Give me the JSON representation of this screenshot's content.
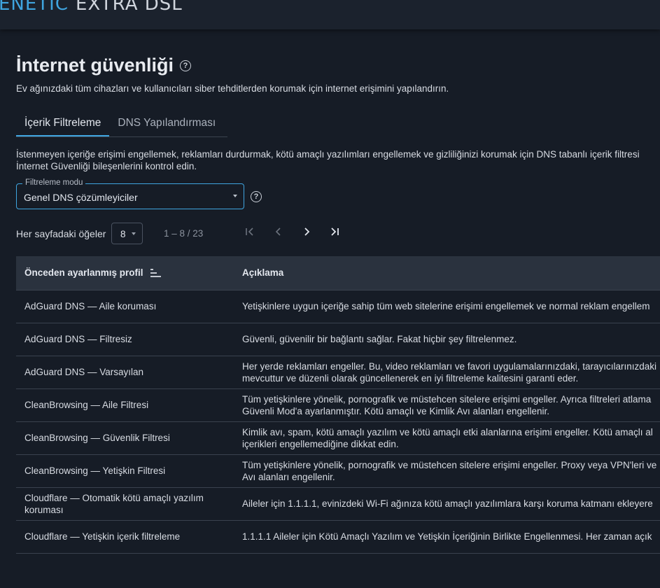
{
  "header": {
    "logo_part1": "ENETIC",
    "logo_part2": "EXTRA DSL"
  },
  "page": {
    "title": "İnternet güvenliği",
    "subtitle": "Ev ağınızdaki tüm cihazları ve kullanıcıları siber tehditlerden korumak için internet erişimini yapılandırın."
  },
  "tabs": [
    {
      "label": "İçerik Filtreleme",
      "active": true
    },
    {
      "label": "DNS Yapılandırması",
      "active": false
    }
  ],
  "content": {
    "description_line1": "İstenmeyen içeriğe erişimi engellemek, reklamları durdurmak, kötü amaçlı yazılımları engellemek ve gizliliğinizi korumak için DNS tabanlı içerik filtresi",
    "description_line2": "İnternet Güvenliği bileşenlerini kontrol edin.",
    "filter_mode": {
      "label": "Filtreleme modu",
      "value": "Genel DNS çözümleyiciler"
    }
  },
  "pagination": {
    "items_per_page_label": "Her sayfadaki öğeler",
    "items_per_page_value": "8",
    "range": "1 – 8 / 23"
  },
  "table": {
    "columns": [
      "Önceden ayarlanmış profil",
      "Açıklama"
    ],
    "rows": [
      {
        "profile": "AdGuard DNS — Aile koruması",
        "description": [
          "Yetişkinlere uygun içeriğe sahip tüm web sitelerine erişimi engellemek ve normal reklam engellem"
        ]
      },
      {
        "profile": "AdGuard DNS — Filtresiz",
        "description": [
          "Güvenli, güvenilir bir bağlantı sağlar. Fakat hiçbir şey filtrelenmez."
        ]
      },
      {
        "profile": "AdGuard DNS — Varsayılan",
        "description": [
          "Her yerde reklamları engeller. Bu, video reklamları ve favori uygulamalarınızdaki, tarayıcılarınızdaki",
          "mevcuttur ve düzenli olarak güncellenerek en iyi filtreleme kalitesini garanti eder."
        ]
      },
      {
        "profile": "CleanBrowsing — Aile Filtresi",
        "description": [
          "Tüm yetişkinlere yönelik, pornografik ve müstehcen sitelere erişimi engeller. Ayrıca filtreleri atlama",
          "Güvenli Mod'a ayarlanmıştır. Kötü amaçlı ve Kimlik Avı alanları engellenir."
        ]
      },
      {
        "profile": "CleanBrowsing — Güvenlik Filtresi",
        "description": [
          "Kimlik avı, spam, kötü amaçlı yazılım ve kötü amaçlı etki alanlarına erişimi engeller. Kötü amaçlı al",
          "içerikleri engellemediğine dikkat edin."
        ]
      },
      {
        "profile": "CleanBrowsing — Yetişkin Filtresi",
        "description": [
          "Tüm yetişkinlere yönelik, pornografik ve müstehcen sitelere erişimi engeller. Proxy veya VPN'leri ve",
          "Avı alanları engellenir."
        ]
      },
      {
        "profile": "Cloudflare — Otomatik kötü amaçlı yazılım koruması",
        "description": [
          "Aileler için 1.1.1.1, evinizdeki Wi-Fi ağınıza kötü amaçlı yazılımlara karşı koruma katmanı ekleyere"
        ]
      },
      {
        "profile": "Cloudflare — Yetişkin içerik filtreleme",
        "description": [
          "1.1.1.1 Aileler için Kötü Amaçlı Yazılım ve Yetişkin İçeriğinin Birlikte Engellenmesi. Her zaman açık"
        ]
      }
    ]
  },
  "colors": {
    "background": "#161c26",
    "accent": "#3fa5e0",
    "header_bg": "#1b222d",
    "table_header_bg": "#2a323e"
  },
  "icons": [
    "help-icon",
    "sort-icon",
    "first-page-icon",
    "prev-page-icon",
    "next-page-icon",
    "last-page-icon",
    "chevron-down-icon"
  ]
}
